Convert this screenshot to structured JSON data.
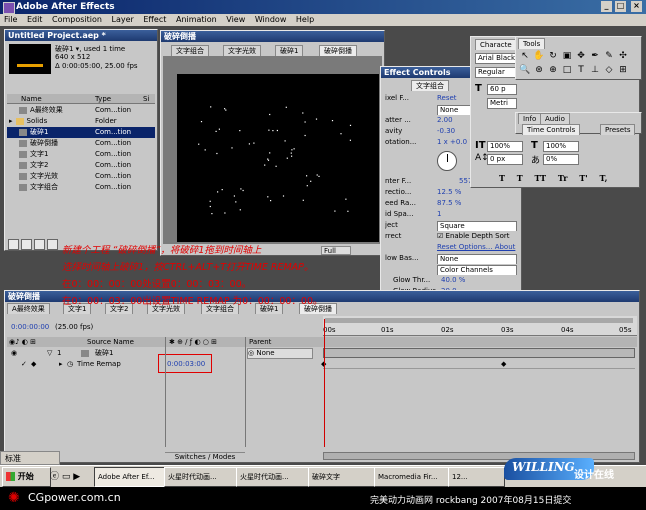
{
  "app": {
    "title": "Adobe After Effects"
  },
  "menu": [
    "File",
    "Edit",
    "Composition",
    "Layer",
    "Effect",
    "Animation",
    "View",
    "Window",
    "Help"
  ],
  "project": {
    "title": "Untitled Project.aep *",
    "comp_name": "破碎1 ▾, used 1 time",
    "comp_size": "640 x 512",
    "comp_dur": "Δ 0:00:05:00, 25.00 fps",
    "col_name": "Name",
    "col_type": "Type",
    "col_size": "Si",
    "items": [
      {
        "name": "A最终效果",
        "type": "Com...tion",
        "color": "#b8b8b8"
      },
      {
        "name": "Solids",
        "type": "Folder",
        "color": "#e8c060"
      },
      {
        "name": "破碎1",
        "type": "Com...tion",
        "color": "#b8b8b8"
      },
      {
        "name": "破碎倒播",
        "type": "Com...tion",
        "color": "#b8b8b8"
      },
      {
        "name": "文字1",
        "type": "Com...tion",
        "color": "#b8b8b8"
      },
      {
        "name": "文字2",
        "type": "Com...tion",
        "color": "#b8b8b8"
      },
      {
        "name": "文字光效",
        "type": "Com...tion",
        "color": "#b8b8b8"
      },
      {
        "name": "文字组合",
        "type": "Com...tion",
        "color": "#b8b8b8"
      }
    ]
  },
  "comp_window": {
    "title": "破碎倒播",
    "tabs": [
      "文字组合",
      "文字光效",
      "破碎1",
      "破碎倒播"
    ],
    "zoom": "Full"
  },
  "effect_controls": {
    "title": "Effect Controls",
    "tab": "文字组合",
    "rows": [
      {
        "label": "ixel F...",
        "value": "Reset"
      },
      {
        "label": "",
        "value": "None"
      },
      {
        "label": "atter ...",
        "value": "2.00"
      },
      {
        "label": "avity",
        "value": "-0.30"
      },
      {
        "label": "otation...",
        "value": "1 x +0.0 °"
      },
      {
        "label": "nter F...",
        "value": "557."
      },
      {
        "label": "rectio...",
        "value": "12.5 %"
      },
      {
        "label": "eed Ra...",
        "value": "87.5 %"
      },
      {
        "label": "id Spa...",
        "value": "1"
      },
      {
        "label": "ject",
        "value": "Square"
      },
      {
        "label": "rrect",
        "value": "Enable Depth Sort"
      },
      {
        "label": "",
        "value": "Reset Options... About"
      }
    ],
    "sub_rows": [
      {
        "label": "low Bas...",
        "value": "None"
      },
      {
        "label": "",
        "value": "Color Channels"
      },
      {
        "label": "Glow Thr...",
        "value": "40.0 %"
      },
      {
        "label": "Glow Radius",
        "value": "20.0"
      }
    ]
  },
  "character": {
    "title": "Characte",
    "font": "Arial Black",
    "style": "Regular",
    "size": "60 p",
    "leading": "Metri",
    "scale_v": "100%",
    "scale_h": "100%",
    "baseline": "0 px",
    "tsume": "0%",
    "styles": [
      "T",
      "T",
      "TT",
      "Tr",
      "T'",
      "T,"
    ]
  },
  "tools": {
    "title": "Tools"
  },
  "info": {
    "tab1": "Info",
    "tab2": "Audio",
    "tab3": "Time Controls",
    "tab4": "Presets"
  },
  "timeline": {
    "title": "破碎倒播",
    "tabs": [
      "A最终效果",
      "文字1",
      "文字2",
      "文字光效",
      "文字组合",
      "破碎1",
      "破碎倒播"
    ],
    "current_time": "0:00:00:00",
    "fps": "(25.00 fps)",
    "col_source": "Source Name",
    "col_parent": "Parent",
    "layer_num": "1",
    "layer_name": "破碎1",
    "layer_parent": "None",
    "prop_name": "Time Remap",
    "prop_value": "0:00:03:00",
    "ruler": [
      "00s",
      "01s",
      "02s",
      "03s",
      "04s",
      "05s"
    ],
    "footer": "Switches / Modes"
  },
  "annotations": [
    "新建个工程 “破碎倒播”，将破碎1拖到时间轴上",
    "选择时间轴上破碎1，按CTRL+ALT+T打开TIME REMAP。",
    "在0：00：00：00处设置0：00：03：00。",
    "在0：00：03：00出设置TIME REMAP 为0：00：00：00。"
  ],
  "taskbar": {
    "start": "开始",
    "items": [
      "Adobe After Ef...",
      "火星时代动画...",
      "火星时代动画...",
      "破碎文字",
      "Macromedia Fir...",
      "12..."
    ],
    "ime": "标准"
  },
  "watermark": {
    "brand": "WILLING",
    "sub": "设计在线",
    "site": "CGpower.com.cn",
    "credit": "完美动力动画网 rockbang 2007年08月15日提交"
  }
}
